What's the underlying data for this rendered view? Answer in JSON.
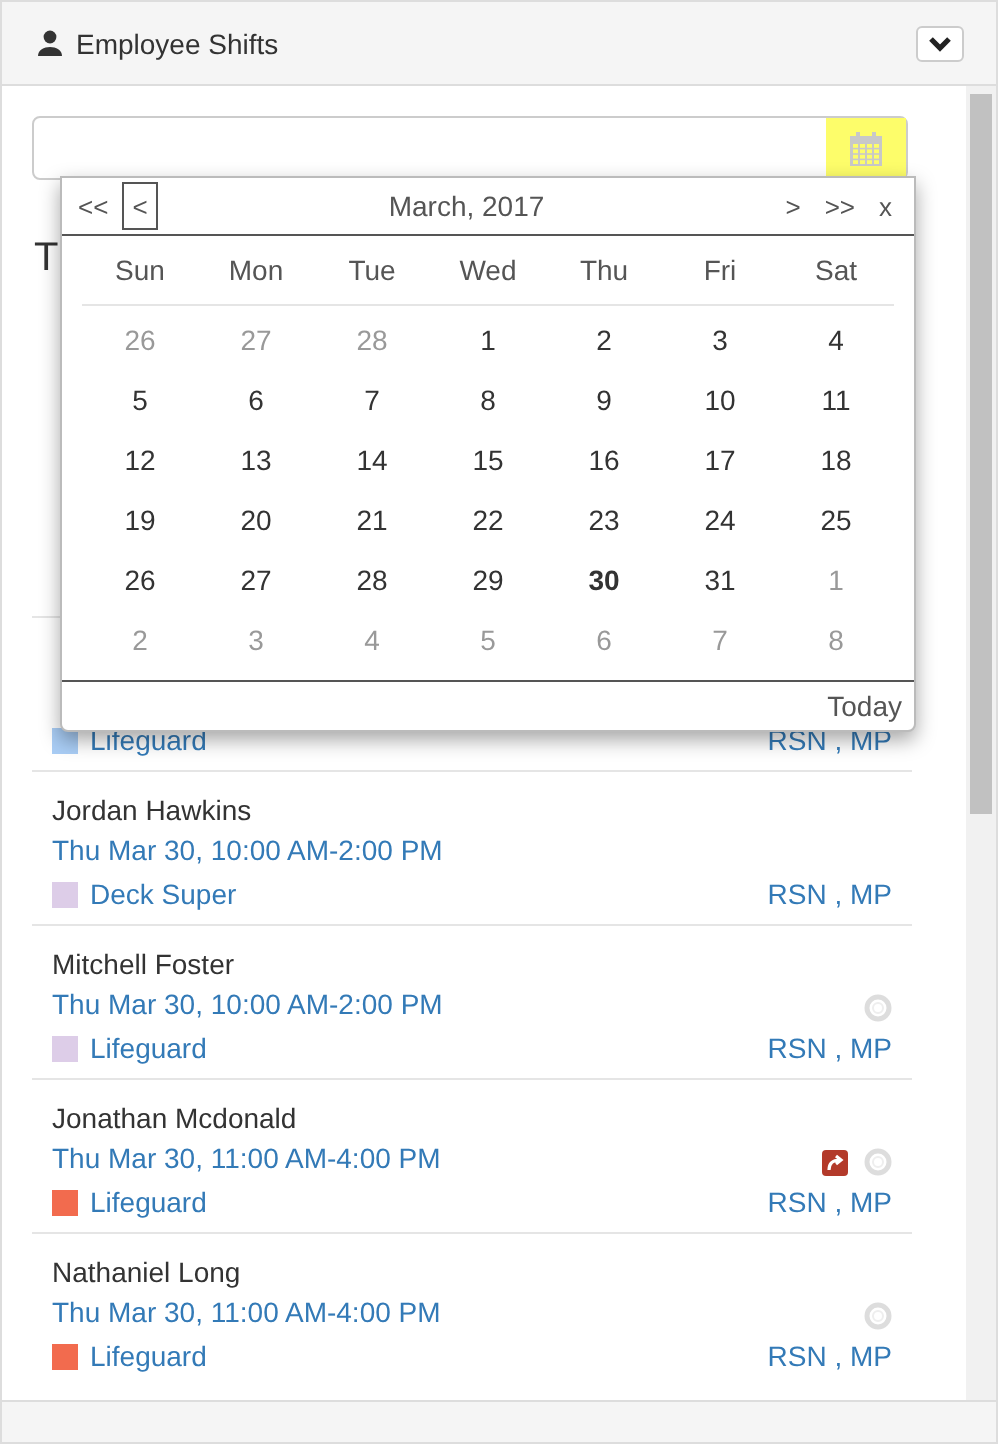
{
  "panel": {
    "title": "Employee Shifts"
  },
  "calendar": {
    "nav_prev_year": "<<",
    "nav_prev_month": "<",
    "month_title": "March, 2017",
    "nav_next_month": ">",
    "nav_next_year": ">>",
    "close": "x",
    "today_button": "Today",
    "weekdays": [
      "Sun",
      "Mon",
      "Tue",
      "Wed",
      "Thu",
      "Fri",
      "Sat"
    ],
    "weeks": [
      [
        {
          "day": "26",
          "other_month": true,
          "selected": false
        },
        {
          "day": "27",
          "other_month": true,
          "selected": false
        },
        {
          "day": "28",
          "other_month": true,
          "selected": false
        },
        {
          "day": "1",
          "other_month": false,
          "selected": false
        },
        {
          "day": "2",
          "other_month": false,
          "selected": false
        },
        {
          "day": "3",
          "other_month": false,
          "selected": false
        },
        {
          "day": "4",
          "other_month": false,
          "selected": false
        }
      ],
      [
        {
          "day": "5",
          "other_month": false,
          "selected": false
        },
        {
          "day": "6",
          "other_month": false,
          "selected": false
        },
        {
          "day": "7",
          "other_month": false,
          "selected": false
        },
        {
          "day": "8",
          "other_month": false,
          "selected": false
        },
        {
          "day": "9",
          "other_month": false,
          "selected": false
        },
        {
          "day": "10",
          "other_month": false,
          "selected": false
        },
        {
          "day": "11",
          "other_month": false,
          "selected": false
        }
      ],
      [
        {
          "day": "12",
          "other_month": false,
          "selected": false
        },
        {
          "day": "13",
          "other_month": false,
          "selected": false
        },
        {
          "day": "14",
          "other_month": false,
          "selected": false
        },
        {
          "day": "15",
          "other_month": false,
          "selected": false
        },
        {
          "day": "16",
          "other_month": false,
          "selected": false
        },
        {
          "day": "17",
          "other_month": false,
          "selected": false
        },
        {
          "day": "18",
          "other_month": false,
          "selected": false
        }
      ],
      [
        {
          "day": "19",
          "other_month": false,
          "selected": false
        },
        {
          "day": "20",
          "other_month": false,
          "selected": false
        },
        {
          "day": "21",
          "other_month": false,
          "selected": false
        },
        {
          "day": "22",
          "other_month": false,
          "selected": false
        },
        {
          "day": "23",
          "other_month": false,
          "selected": false
        },
        {
          "day": "24",
          "other_month": false,
          "selected": false
        },
        {
          "day": "25",
          "other_month": false,
          "selected": false
        }
      ],
      [
        {
          "day": "26",
          "other_month": false,
          "selected": false
        },
        {
          "day": "27",
          "other_month": false,
          "selected": false
        },
        {
          "day": "28",
          "other_month": false,
          "selected": false
        },
        {
          "day": "29",
          "other_month": false,
          "selected": false
        },
        {
          "day": "30",
          "other_month": false,
          "selected": true
        },
        {
          "day": "31",
          "other_month": false,
          "selected": false
        },
        {
          "day": "1",
          "other_month": true,
          "selected": false
        }
      ],
      [
        {
          "day": "2",
          "other_month": true,
          "selected": false
        },
        {
          "day": "3",
          "other_month": true,
          "selected": false
        },
        {
          "day": "4",
          "other_month": true,
          "selected": false
        },
        {
          "day": "5",
          "other_month": true,
          "selected": false
        },
        {
          "day": "6",
          "other_month": true,
          "selected": false
        },
        {
          "day": "7",
          "other_month": true,
          "selected": false
        },
        {
          "day": "8",
          "other_month": true,
          "selected": false
        }
      ]
    ]
  },
  "list": {
    "heading": "T",
    "shifts": [
      {
        "role": "Lifeguard",
        "color": "#a9cdf5",
        "assignees": "RSN , MP"
      },
      {
        "name": "Jordan Hawkins",
        "time": "Thu Mar 30, 10:00 AM-2:00 PM",
        "role": "Deck Super",
        "color": "#ddcde8",
        "assignees": "RSN , MP",
        "swap": false,
        "lifebuoy": false
      },
      {
        "name": "Mitchell Foster",
        "time": "Thu Mar 30, 10:00 AM-2:00 PM",
        "role": "Lifeguard",
        "color": "#ddcde8",
        "assignees": "RSN , MP",
        "swap": false,
        "lifebuoy": true
      },
      {
        "name": "Jonathan Mcdonald",
        "time": "Thu Mar 30, 11:00 AM-4:00 PM",
        "role": "Lifeguard",
        "color": "#f26b4e",
        "assignees": "RSN , MP",
        "swap": true,
        "lifebuoy": true
      },
      {
        "name": "Nathaniel Long",
        "time": "Thu Mar 30, 11:00 AM-4:00 PM",
        "role": "Lifeguard",
        "color": "#f26b4e",
        "assignees": "RSN , MP",
        "swap": false,
        "lifebuoy": true
      }
    ]
  }
}
